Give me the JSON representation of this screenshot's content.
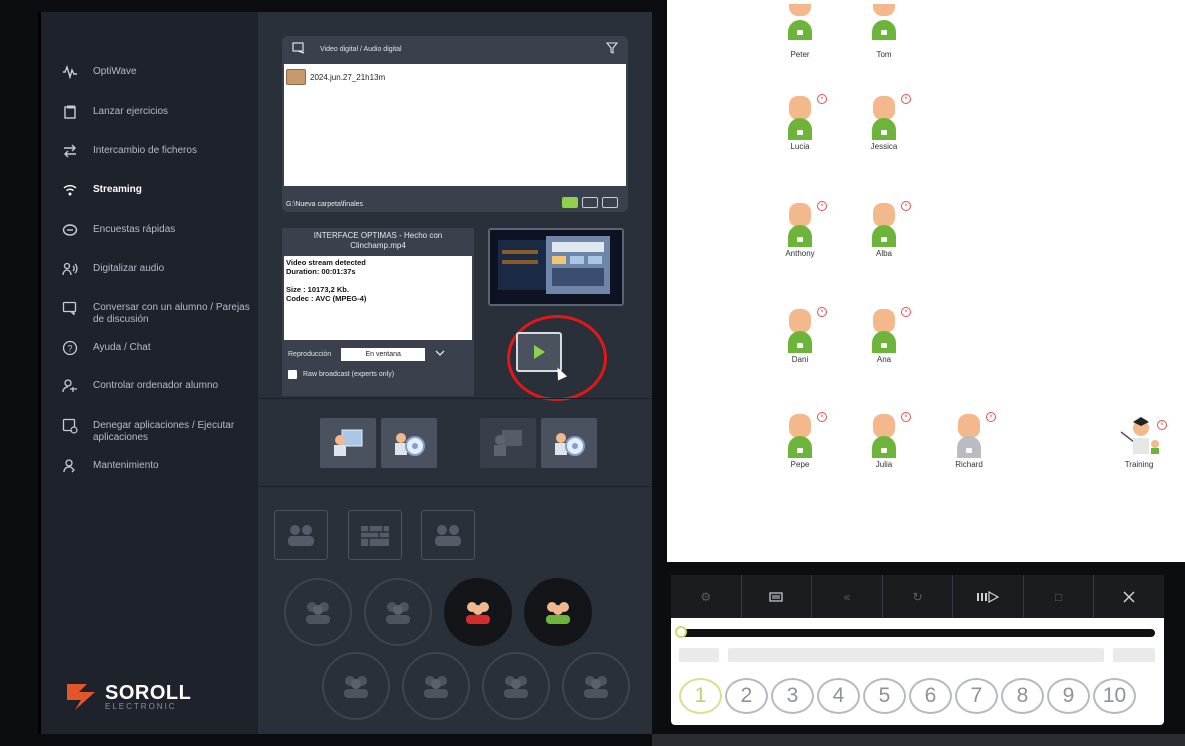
{
  "sidebar": {
    "items": [
      {
        "label": "OptiWave",
        "icon": "wave-icon"
      },
      {
        "label": "Lanzar ejercicios",
        "icon": "launch-icon"
      },
      {
        "label": "Intercambio de ficheros",
        "icon": "exchange-icon"
      },
      {
        "label": "Streaming",
        "icon": "wifi-icon",
        "active": true
      },
      {
        "label": "Encuestas rápidas",
        "icon": "poll-icon"
      },
      {
        "label": "Digitalizar audio",
        "icon": "audio-icon"
      },
      {
        "label": "Conversar con un alumno / Parejas de discusión",
        "icon": "chat-icon"
      },
      {
        "label": "Ayuda / Chat",
        "icon": "help-icon"
      },
      {
        "label": "Controlar ordenador alumno",
        "icon": "remote-icon"
      },
      {
        "label": "Denegar aplicaciones / Ejecutar aplicaciones",
        "icon": "apps-icon"
      },
      {
        "label": "Mantenimiento",
        "icon": "maintenance-icon"
      }
    ],
    "logo": {
      "name": "SOROLL",
      "sub": "ELECTRONIC"
    }
  },
  "file_panel": {
    "header": "Video digital / Audio digital",
    "files": [
      "2024.jun.27_21h13m"
    ],
    "path": "G:\\Nueva carpeta\\finales"
  },
  "info_panel": {
    "title": "INTERFACE OPTIMAS - Hecho con Clinchamp.mp4",
    "lines": [
      "Video stream detected",
      "Duration: 00:01:37s",
      "",
      "Size : 10173,2 Kb.",
      "Codec : AVC (MPEG-4)"
    ],
    "repro_label": "Reproducción",
    "repro_value": "En ventana",
    "raw_label": "Raw broadcast (experts only)"
  },
  "students": [
    {
      "name": "Peter"
    },
    {
      "name": "Tom"
    },
    {
      "name": "Lucia"
    },
    {
      "name": "Jessica"
    },
    {
      "name": "Anthony"
    },
    {
      "name": "Alba"
    },
    {
      "name": "Dani"
    },
    {
      "name": "Ana"
    },
    {
      "name": "Pepe"
    },
    {
      "name": "Julia"
    },
    {
      "name": "Richard"
    },
    {
      "name": "Training"
    }
  ],
  "player": {
    "numbers": [
      "1",
      "2",
      "3",
      "4",
      "5",
      "6",
      "7",
      "8",
      "9",
      "10"
    ],
    "progress": 0.0
  },
  "colors": {
    "accent_green": "#8fd04c",
    "highlight_red": "#e21818",
    "avatar_skin": "#f3b98d",
    "avatar_shirt": "#6cb43a"
  }
}
